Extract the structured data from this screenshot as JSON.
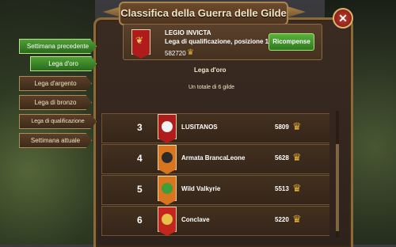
{
  "window": {
    "title": "Classifica della Guerra delle Gilde"
  },
  "header": {
    "guild_name": "LEGIO INVICTA",
    "league_line": "Lega di qualificazione, posizione 1",
    "score": "582720",
    "reward_button": "Ricompense"
  },
  "league": {
    "title": "Lega d'oro",
    "count_text": "Un totale di 6 gilde"
  },
  "tabs": [
    {
      "label": "Settimana precedente",
      "active": true
    },
    {
      "label": "Lega d'oro",
      "active": true
    },
    {
      "label": "Lega d'argento",
      "active": false
    },
    {
      "label": "Lega di bronzo",
      "active": false
    },
    {
      "label": "Lega di qualificazione",
      "active": false
    },
    {
      "label": "Settimana attuale",
      "active": false
    }
  ],
  "rows": [
    {
      "rank": "3",
      "name": "LUSITANOS",
      "score": "5809",
      "banner_color": "#b01c1c",
      "emblem_color": "#f2f2f2"
    },
    {
      "rank": "4",
      "name": "Armata BrancaLeone",
      "score": "5628",
      "banner_color": "#d9751e",
      "emblem_color": "#2b2b2b"
    },
    {
      "rank": "5",
      "name": "Wild Valkyrie",
      "score": "5513",
      "banner_color": "#d9751e",
      "emblem_color": "#3d9e3a"
    },
    {
      "rank": "6",
      "name": "Conclave",
      "score": "5220",
      "banner_color": "#c2261f",
      "emblem_color": "#e8c14a"
    }
  ],
  "icons": {
    "score": "guild-war-points-icon",
    "close": "close-icon",
    "hdr_emblem": "laurel-icon"
  }
}
